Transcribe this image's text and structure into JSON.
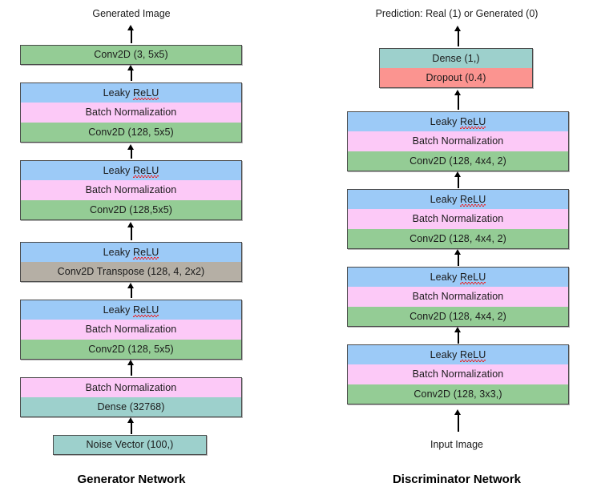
{
  "diagram": {
    "title": "GAN architecture diagram",
    "colors": {
      "conv2d": "#94cc95",
      "leaky_relu": "#9ccaf7",
      "batch_norm": "#fcc9f7",
      "dense": "#9dd0cc",
      "dropout": "#fb9490",
      "conv2d_transpose": "#b5afa5",
      "border": "#4a4a4a",
      "background": "#ffffff",
      "spellcheck_underline": "#e8262a"
    },
    "generator": {
      "title": "Generator Network",
      "output_caption": "Generated Image",
      "blocks": [
        {
          "name": "output-conv-block",
          "layers": [
            {
              "label": "Conv2D (3, 5x5)",
              "type": "conv2d"
            }
          ]
        },
        {
          "name": "conv-block-1",
          "layers": [
            {
              "label": "Leaky ReLU",
              "type": "leaky_relu",
              "spellcheck_word": "ReLU"
            },
            {
              "label": "Batch Normalization",
              "type": "batch_norm"
            },
            {
              "label": "Conv2D (128, 5x5)",
              "type": "conv2d"
            }
          ]
        },
        {
          "name": "conv-block-2",
          "layers": [
            {
              "label": "Leaky ReLU",
              "type": "leaky_relu",
              "spellcheck_word": "ReLU"
            },
            {
              "label": "Batch Normalization",
              "type": "batch_norm"
            },
            {
              "label": "Conv2D (128,5x5)",
              "type": "conv2d"
            }
          ]
        },
        {
          "name": "transpose-block",
          "layers": [
            {
              "label": "Leaky ReLU",
              "type": "leaky_relu",
              "spellcheck_word": "ReLU"
            },
            {
              "label": "Conv2D Transpose (128, 4, 2x2)",
              "type": "conv2d_transpose"
            }
          ]
        },
        {
          "name": "conv-block-3",
          "layers": [
            {
              "label": "Leaky ReLU",
              "type": "leaky_relu",
              "spellcheck_word": "ReLU"
            },
            {
              "label": "Batch Normalization",
              "type": "batch_norm"
            },
            {
              "label": "Conv2D (128, 5x5)",
              "type": "conv2d"
            }
          ]
        },
        {
          "name": "dense-block",
          "layers": [
            {
              "label": "Batch Normalization",
              "type": "batch_norm"
            },
            {
              "label": "Dense (32768)",
              "type": "dense"
            }
          ]
        },
        {
          "name": "input-block",
          "layers": [
            {
              "label": "Noise Vector (100,)",
              "type": "dense"
            }
          ]
        }
      ]
    },
    "discriminator": {
      "title": "Discriminator Network",
      "output_caption": "Prediction: Real (1) or Generated (0)",
      "input_caption": "Input Image",
      "blocks": [
        {
          "name": "head-block",
          "layers": [
            {
              "label": "Dense (1,)",
              "type": "dense"
            },
            {
              "label": "Dropout (0.4)",
              "type": "dropout"
            }
          ]
        },
        {
          "name": "conv-block-1",
          "layers": [
            {
              "label": "Leaky ReLU",
              "type": "leaky_relu",
              "spellcheck_word": "ReLU"
            },
            {
              "label": "Batch Normalization",
              "type": "batch_norm"
            },
            {
              "label": "Conv2D (128, 4x4, 2)",
              "type": "conv2d"
            }
          ]
        },
        {
          "name": "conv-block-2",
          "layers": [
            {
              "label": "Leaky ReLU",
              "type": "leaky_relu",
              "spellcheck_word": "ReLU"
            },
            {
              "label": "Batch Normalization",
              "type": "batch_norm"
            },
            {
              "label": "Conv2D (128, 4x4, 2)",
              "type": "conv2d"
            }
          ]
        },
        {
          "name": "conv-block-3",
          "layers": [
            {
              "label": "Leaky ReLU",
              "type": "leaky_relu",
              "spellcheck_word": "ReLU"
            },
            {
              "label": "Batch Normalization",
              "type": "batch_norm"
            },
            {
              "label": "Conv2D (128, 4x4, 2)",
              "type": "conv2d"
            }
          ]
        },
        {
          "name": "conv-block-4",
          "layers": [
            {
              "label": "Leaky ReLU",
              "type": "leaky_relu",
              "spellcheck_word": "ReLU"
            },
            {
              "label": "Batch Normalization",
              "type": "batch_norm"
            },
            {
              "label": "Conv2D (128, 3x3,)",
              "type": "conv2d"
            }
          ]
        }
      ]
    }
  }
}
